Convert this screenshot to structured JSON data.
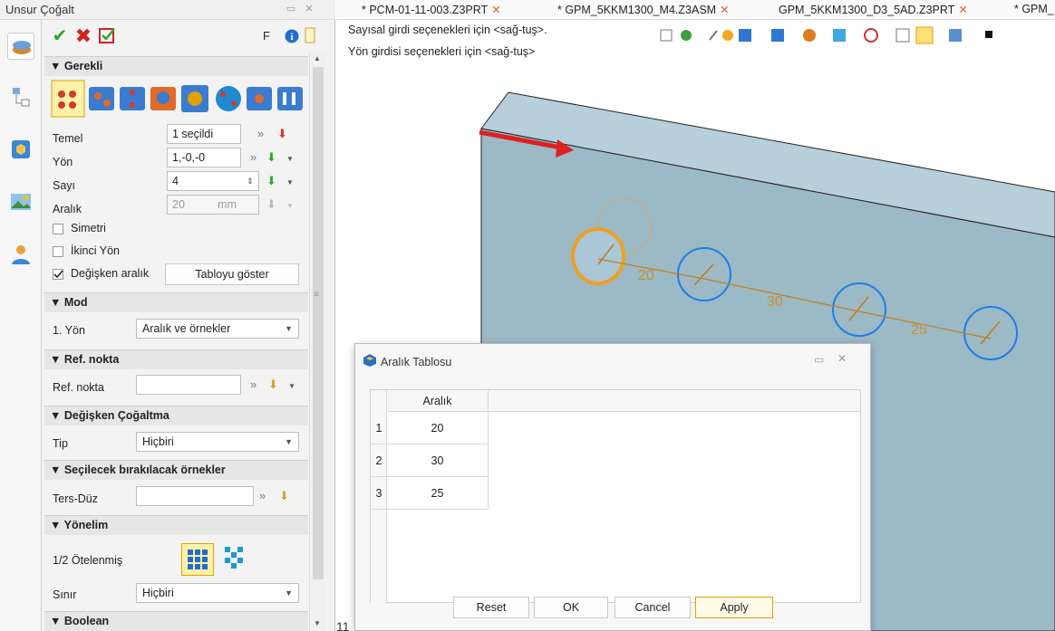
{
  "panel": {
    "title": "Unsur Çoğalt",
    "toolbar": {
      "f_label": "F"
    },
    "sections": {
      "required": "▼ Gerekli",
      "mode": "▼ Mod",
      "ref": "▼ Ref. nokta",
      "variable": "▼ Değişken Çoğaltma",
      "selection": "▼ Seçilecek bırakılacak örnekler",
      "orientation": "▼ Yönelim",
      "boolean": "▼ Boolean"
    },
    "fields": {
      "base_label": "Temel",
      "base_value": "1 seçildi",
      "dir_label": "Yön",
      "dir_value": "1,-0,-0",
      "count_label": "Sayı",
      "count_value": "4",
      "spacing_label": "Aralık",
      "spacing_value": "20",
      "spacing_unit": "mm",
      "symmetric_label": "Simetri",
      "symmetric_checked": false,
      "second_dir_label": "İkinci Yön",
      "second_dir_checked": false,
      "variable_spacing_label": "Değişken aralık",
      "variable_spacing_checked": true,
      "show_table_button": "Tabloyu göster",
      "mode_label": "1. Yön",
      "mode_value": "Aralık ve örnekler",
      "ref_label": "Ref. nokta",
      "ref_value": "",
      "type_label": "Tip",
      "type_value": "Hiçbiri",
      "toggle_label": "Ters-Düz",
      "toggle_value": "",
      "half_offset_label": "1/2 Ötelenmiş",
      "limit_label": "Sınır",
      "limit_value": "Hiçbiri"
    }
  },
  "tabs": [
    {
      "label": "* PCM-01-11-003.Z3PRT"
    },
    {
      "label": "* GPM_5KKM1300_M4.Z3ASM"
    },
    {
      "label": "GPM_5KKM1300_D3_5AD.Z3PRT"
    },
    {
      "label": "* GPM_"
    }
  ],
  "viewport": {
    "hint1": "Sayısal girdi seçenekleri için <sağ-tuş>.",
    "hint2": "Yön girdisi seçenekleri için <sağ-tuş>",
    "dim1": "20",
    "dim2": "30",
    "dim3": "25",
    "corner_text": "11"
  },
  "dialog": {
    "title": "Aralık Tablosu",
    "column_header": "Aralık",
    "rows": [
      {
        "index": "1",
        "value": "20"
      },
      {
        "index": "2",
        "value": "30"
      },
      {
        "index": "3",
        "value": "25"
      }
    ],
    "buttons": {
      "reset": "Reset",
      "ok": "OK",
      "cancel": "Cancel",
      "apply": "Apply"
    }
  },
  "colors": {
    "accent": "#f0a020",
    "face": "#9cb9c6",
    "selection_blue": "#1e7ee8",
    "arrow_red": "#e02020"
  }
}
